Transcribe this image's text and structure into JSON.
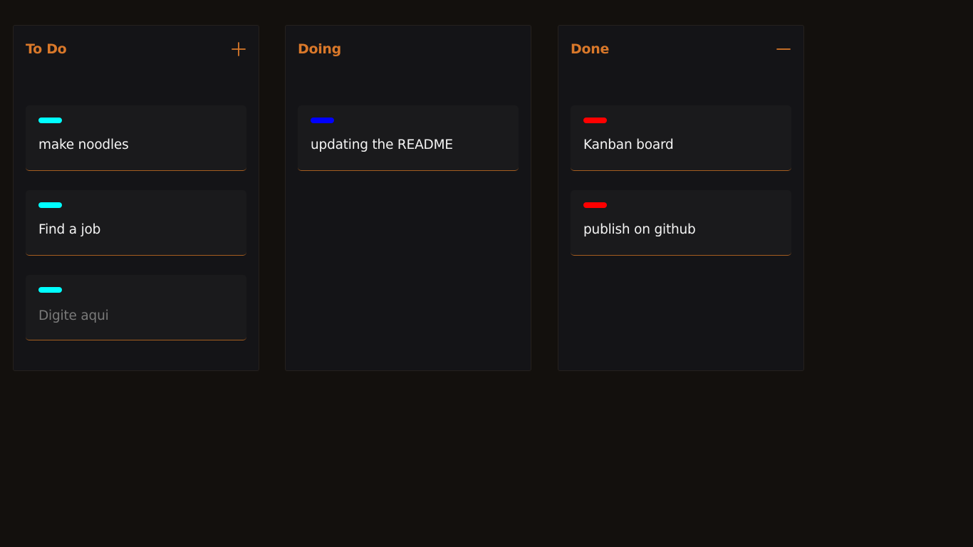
{
  "colors": {
    "background": "#13100d",
    "column_bg": "#141417",
    "card_bg": "#1a1a1c",
    "accent": "#d9782a",
    "tag_cyan": "#00ffff",
    "tag_blue": "#0000ff",
    "tag_red": "#ff0000"
  },
  "columns": [
    {
      "title": "To Do",
      "action_icon": "plus-icon",
      "cards": [
        {
          "text": "make noodles",
          "tag_color": "#00ffff"
        },
        {
          "text": "Find a job",
          "tag_color": "#00ffff"
        },
        {
          "text": "",
          "placeholder": "Digite aqui",
          "tag_color": "#00ffff"
        }
      ]
    },
    {
      "title": "Doing",
      "cards": [
        {
          "text": "updating the README",
          "tag_color": "#0000ff"
        }
      ]
    },
    {
      "title": "Done",
      "action_icon": "minus-icon",
      "cards": [
        {
          "text": "Kanban board",
          "tag_color": "#ff0000"
        },
        {
          "text": "publish on github",
          "tag_color": "#ff0000"
        }
      ]
    }
  ]
}
